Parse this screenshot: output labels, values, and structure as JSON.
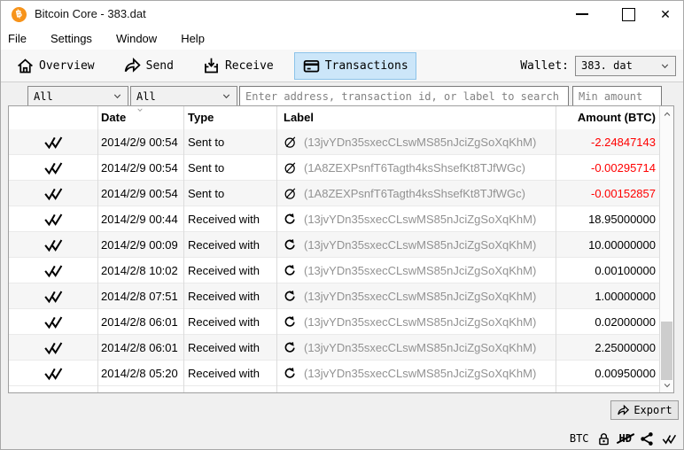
{
  "window": {
    "title": "Bitcoin Core - 383.dat",
    "logo_glyph": "฿"
  },
  "menu_bar": {
    "items": [
      "File",
      "Settings",
      "Window",
      "Help"
    ]
  },
  "toolbar": {
    "buttons": [
      {
        "label": "Overview",
        "icon": "home-icon",
        "active": false
      },
      {
        "label": "Send",
        "icon": "send-icon",
        "active": false
      },
      {
        "label": "Receive",
        "icon": "receive-icon",
        "active": false
      },
      {
        "label": "Transactions",
        "icon": "transactions-icon",
        "active": true
      }
    ],
    "wallet_label": "Wallet:",
    "wallet_selected": "383. dat"
  },
  "filter_bar": {
    "date_filter_value": "All",
    "type_filter_value": "All",
    "search_placeholder": "Enter address, transaction id, or label to search",
    "min_amount_placeholder": "Min amount"
  },
  "transactions_table": {
    "headers": {
      "date": "Date",
      "type": "Type",
      "label": "Label",
      "amount": "Amount (BTC)"
    },
    "sorted_by": "Date",
    "rows": [
      {
        "status": "confirmed",
        "date": "2014/2/9 00:54",
        "type": "Sent to",
        "label": "(13jvYDn35sxecCLswMS85nJciZgSoXqKhM)",
        "amount": "-2.24847143"
      },
      {
        "status": "confirmed",
        "date": "2014/2/9 00:54",
        "type": "Sent to",
        "label": "(1A8ZEXPsnfT6Tagth4ksShsefKt8TJfWGc)",
        "amount": "-0.00295714"
      },
      {
        "status": "confirmed",
        "date": "2014/2/9 00:54",
        "type": "Sent to",
        "label": "(1A8ZEXPsnfT6Tagth4ksShsefKt8TJfWGc)",
        "amount": "-0.00152857"
      },
      {
        "status": "confirmed",
        "date": "2014/2/9 00:44",
        "type": "Received with",
        "label": "(13jvYDn35sxecCLswMS85nJciZgSoXqKhM)",
        "amount": "18.95000000"
      },
      {
        "status": "confirmed",
        "date": "2014/2/9 00:09",
        "type": "Received with",
        "label": "(13jvYDn35sxecCLswMS85nJciZgSoXqKhM)",
        "amount": "10.00000000"
      },
      {
        "status": "confirmed",
        "date": "2014/2/8 10:02",
        "type": "Received with",
        "label": "(13jvYDn35sxecCLswMS85nJciZgSoXqKhM)",
        "amount": "0.00100000"
      },
      {
        "status": "confirmed",
        "date": "2014/2/8 07:51",
        "type": "Received with",
        "label": "(13jvYDn35sxecCLswMS85nJciZgSoXqKhM)",
        "amount": "1.00000000"
      },
      {
        "status": "confirmed",
        "date": "2014/2/8 06:01",
        "type": "Received with",
        "label": "(13jvYDn35sxecCLswMS85nJciZgSoXqKhM)",
        "amount": "0.02000000"
      },
      {
        "status": "confirmed",
        "date": "2014/2/8 06:01",
        "type": "Received with",
        "label": "(13jvYDn35sxecCLswMS85nJciZgSoXqKhM)",
        "amount": "2.25000000"
      },
      {
        "status": "confirmed",
        "date": "2014/2/8 05:20",
        "type": "Received with",
        "label": "(13jvYDn35sxecCLswMS85nJciZgSoXqKhM)",
        "amount": "0.00950000"
      }
    ]
  },
  "export_button": {
    "label": "Export"
  },
  "status_bar": {
    "unit": "BTC",
    "icons": [
      "lock-icon",
      "hd-disabled-icon",
      "peers-icon",
      "sync-check-icon"
    ],
    "hd_text": "HD"
  },
  "colors": {
    "bitcoin_orange": "#f7931a",
    "negative_amount": "#ff0000",
    "active_tab_bg": "#cce6f9",
    "active_tab_border": "#8cc3e9",
    "muted_label": "#929292"
  }
}
